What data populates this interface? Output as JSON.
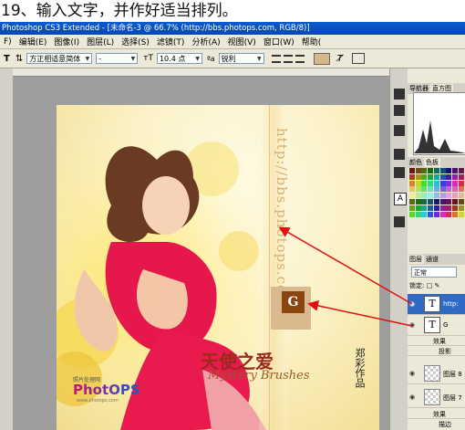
{
  "step_caption": "19、输入文字，并作好适当排列。",
  "window_title": "Photoshop CS3 Extended - [未命名-3 @ 66.7% (http://bbs.photops.com, RGB/8)]",
  "menu": [
    "F)",
    "编辑(E)",
    "图像(I)",
    "图层(L)",
    "选择(S)",
    "滤镜(T)",
    "分析(A)",
    "视图(V)",
    "窗口(W)",
    "帮助("
  ],
  "options": {
    "font_family": "方正相适意简体",
    "font_style": "-",
    "font_size": "10.4 点",
    "aa_mode": "锐利"
  },
  "image_text": {
    "watermark_url": "http://bbs.photops.com",
    "letter_box": "G",
    "title_cn": "天使之爱",
    "title_en": "Mystery Brushes",
    "signature": "郑彩作品",
    "logo_sub": "照片处理网",
    "logo": "PhotOPS",
    "logo_url": "www.photops.com"
  },
  "panels": {
    "tab_navigator": "导航器",
    "tab_histogram": "直方图",
    "tab_color": "颜色",
    "tab_swatches": "色板",
    "tab_layers": "图层",
    "tab_channels": "通道",
    "blend_mode": "正常",
    "lock_label": "锁定:",
    "layers": [
      {
        "name": "http:",
        "type": "text",
        "selected": true
      },
      {
        "name": "G",
        "type": "text",
        "selected": false
      },
      {
        "name": "效果",
        "type": "effect",
        "selected": false
      },
      {
        "name": "投影",
        "type": "effect-item",
        "selected": false
      },
      {
        "name": "图层 8",
        "type": "pixel",
        "selected": false
      },
      {
        "name": "图层 7",
        "type": "pixel",
        "selected": false
      },
      {
        "name": "效果",
        "type": "effect",
        "selected": false
      },
      {
        "name": "描边",
        "type": "effect-item",
        "selected": false
      }
    ]
  },
  "colors": {
    "arrow": "#e01010",
    "selection": "#316ac5",
    "title_bar": "#0a5bd0"
  }
}
